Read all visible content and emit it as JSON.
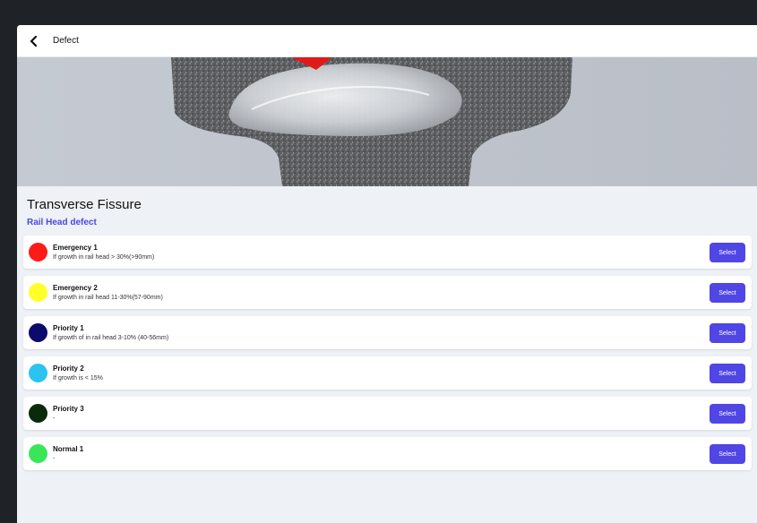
{
  "header": {
    "title": "Defect",
    "back_icon": "chevron-left-icon"
  },
  "defect": {
    "title": "Transverse Fissure",
    "subtitle": "Rail Head defect"
  },
  "colors": {
    "accent": "#4f46e5"
  },
  "categories": [
    {
      "name": "Emergency 1",
      "description": "If growth in rail head > 30%(>90mm)",
      "color": "#ff1a1a",
      "button_label": "Select"
    },
    {
      "name": "Emergency 2",
      "description": "If growth in rail head  11-30%(57-90mm)",
      "color": "#ffff2a",
      "button_label": "Select"
    },
    {
      "name": "Priority 1",
      "description": "If growth of in rail head 3-10% (40-56mm)",
      "color": "#0b0b6e",
      "button_label": "Select"
    },
    {
      "name": "Priority 2",
      "description": "If growth is < 15%",
      "color": "#2bc3f0",
      "button_label": "Select"
    },
    {
      "name": "Priority 3",
      "description": "-",
      "color": "#0b2a0b",
      "button_label": "Select"
    },
    {
      "name": "Normal 1",
      "description": "-",
      "color": "#39e65a",
      "button_label": "Select"
    }
  ]
}
